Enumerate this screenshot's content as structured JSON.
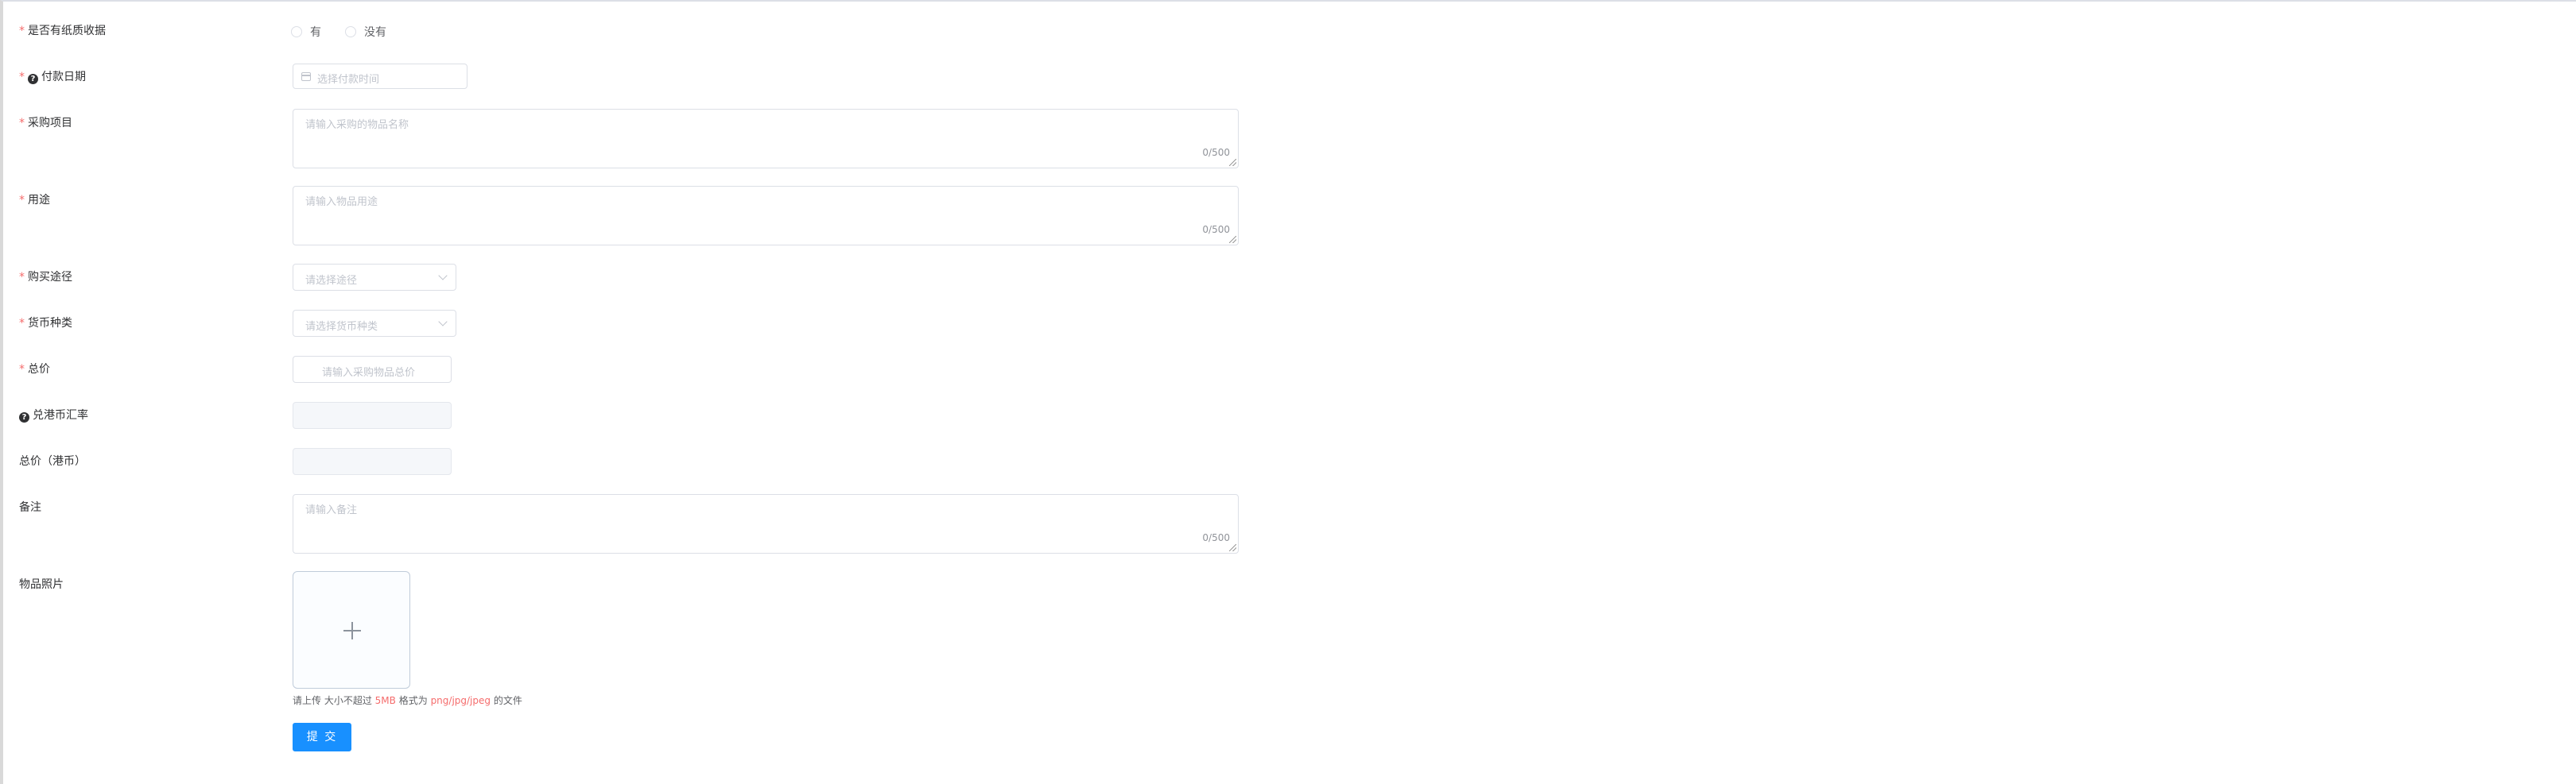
{
  "form": {
    "receipt": {
      "label": "是否有纸质收据",
      "opt_yes": "有",
      "opt_no": "没有"
    },
    "pay_date": {
      "label": "付款日期",
      "placeholder": "选择付款时间"
    },
    "items": {
      "label": "采购项目",
      "placeholder": "请输入采购的物品名称",
      "count": "0/500"
    },
    "usage": {
      "label": "用途",
      "placeholder": "请输入物品用途",
      "count": "0/500"
    },
    "channel": {
      "label": "购买途径",
      "placeholder": "请选择途径"
    },
    "currency": {
      "label": "货币种类",
      "placeholder": "请选择货币种类"
    },
    "total": {
      "label": "总价",
      "placeholder": "请输入采购物品总价"
    },
    "rate": {
      "label": "兑港币汇率"
    },
    "total_hkd": {
      "label": "总价（港币）"
    },
    "remark": {
      "label": "备注",
      "placeholder": "请输入备注",
      "count": "0/500"
    },
    "photo": {
      "label": "物品照片"
    }
  },
  "upload_tip": {
    "prefix": "请上传 大小不超过",
    "size": "5MB",
    "middle": "格式为",
    "formats": "png/jpg/jpeg",
    "suffix": "的文件"
  },
  "submit_label": "提 交",
  "icons": {
    "required": "*",
    "help": "question-circle-icon",
    "calendar": "calendar-icon",
    "dropdown": "chevron-down-icon",
    "upload": "plus-icon"
  },
  "colors": {
    "primary": "#1890ff",
    "required": "#f56c6c",
    "border": "#dcdfe6"
  }
}
